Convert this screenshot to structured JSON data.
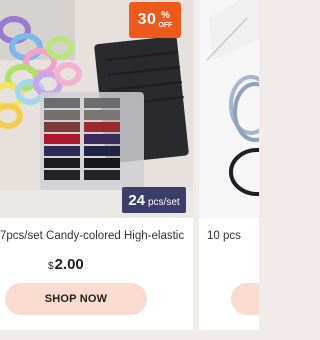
{
  "products": [
    {
      "discount_number": "30",
      "discount_symbol": "%",
      "discount_label": "OFF",
      "pack_count": "24",
      "pack_unit": "pcs/set",
      "title": "7pcs/set Candy-colored High-elastic",
      "currency": "$",
      "price": "2.00",
      "button": "SHOP NOW",
      "colors": {
        "badge": "#ef5a1c",
        "pack_badge": "#3b3e6a",
        "button": "#f9dccf"
      }
    },
    {
      "title": "10 pcs"
    }
  ]
}
